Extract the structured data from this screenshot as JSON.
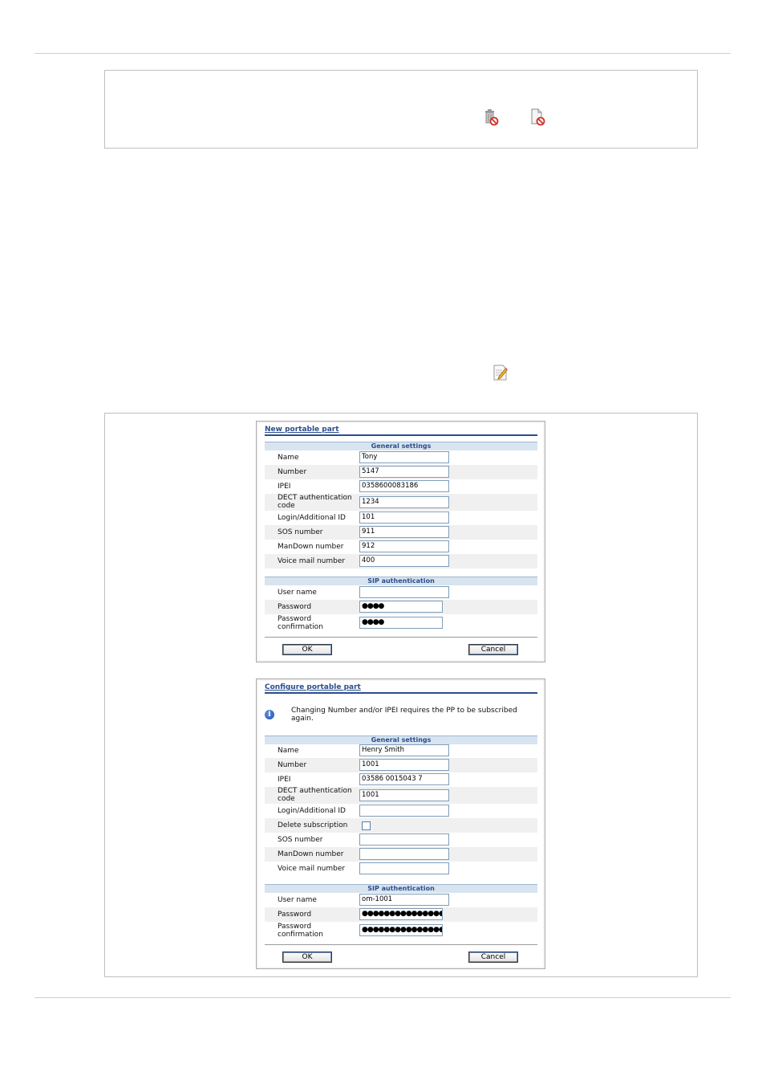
{
  "top_box": {
    "icons": [
      "trash-delete-icon",
      "document-delete-icon"
    ]
  },
  "edit_icon": "edit-pencil-icon",
  "new_pp": {
    "title": "New portable part",
    "general_title": "General settings",
    "sip_title": "SIP authentication",
    "fields": [
      {
        "label": "Name",
        "value": "Tony"
      },
      {
        "label": "Number",
        "value": "5147"
      },
      {
        "label": "IPEI",
        "value": "0358600083186"
      },
      {
        "label": "DECT authentication code",
        "value": "1234"
      },
      {
        "label": "Login/Additional ID",
        "value": "101"
      },
      {
        "label": "SOS number",
        "value": "911"
      },
      {
        "label": "ManDown number",
        "value": "912"
      },
      {
        "label": "Voice mail number",
        "value": "400"
      }
    ],
    "sip_fields": [
      {
        "label": "User name",
        "value": ""
      },
      {
        "label": "Password",
        "value": "●●●●"
      },
      {
        "label": "Password confirmation",
        "value": "●●●●"
      }
    ],
    "ok_label": "OK",
    "cancel_label": "Cancel"
  },
  "cfg_pp": {
    "title": "Configure portable part",
    "info": "Changing Number and/or IPEI requires the PP to be subscribed again.",
    "general_title": "General settings",
    "sip_title": "SIP authentication",
    "fields": [
      {
        "label": "Name",
        "value": "Henry Smith"
      },
      {
        "label": "Number",
        "value": "1001"
      },
      {
        "label": "IPEI",
        "value": "03586 0015043 7"
      },
      {
        "label": "DECT authentication code",
        "value": "1001"
      },
      {
        "label": "Login/Additional ID",
        "value": ""
      },
      {
        "label": "Delete subscription",
        "value": ""
      },
      {
        "label": "SOS number",
        "value": ""
      },
      {
        "label": "ManDown number",
        "value": ""
      },
      {
        "label": "Voice mail number",
        "value": ""
      }
    ],
    "sip_fields": [
      {
        "label": "User name",
        "value": "om-1001"
      },
      {
        "label": "Password",
        "value": "●●●●●●●●●●●●●●●●●●"
      },
      {
        "label": "Password confirmation",
        "value": "●●●●●●●●●●●●●●●●●●"
      }
    ],
    "ok_label": "OK",
    "cancel_label": "Cancel"
  }
}
